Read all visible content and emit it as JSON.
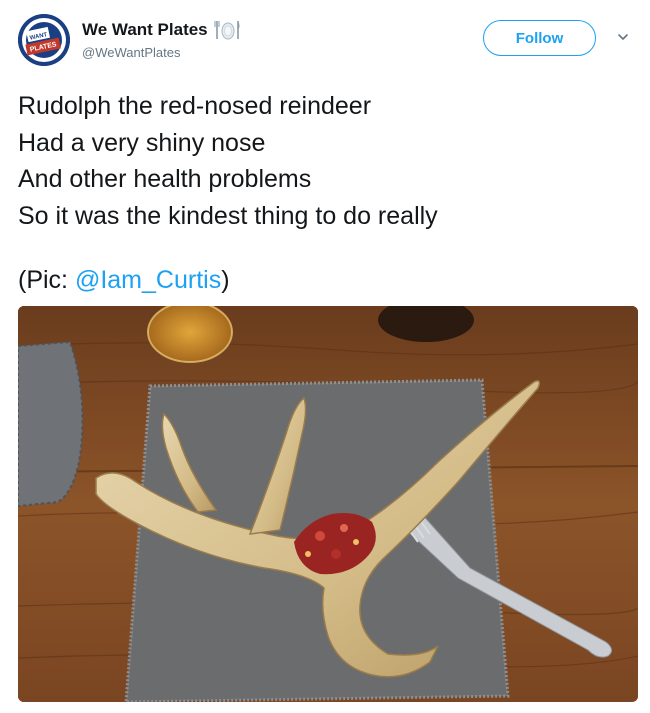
{
  "account": {
    "display_name": "We Want Plates",
    "handle": "@WeWantPlates",
    "avatar_text_top": "WANT",
    "avatar_text_bottom": "PLATES"
  },
  "actions": {
    "follow_label": "Follow"
  },
  "tweet": {
    "lines": [
      "Rudolph the red-nosed reindeer",
      "Had a very shiny nose",
      "And other health problems",
      "So it was the kindest thing to do really"
    ],
    "credit_prefix": "(Pic: ",
    "credit_mention": "@Iam_Curtis",
    "credit_suffix": ")"
  },
  "colors": {
    "accent": "#1da1f2",
    "text": "#14171a",
    "secondary_text": "#657786"
  },
  "icons": {
    "verified_like_plate": "plate-cutlery-icon",
    "menu": "chevron-down-icon"
  }
}
